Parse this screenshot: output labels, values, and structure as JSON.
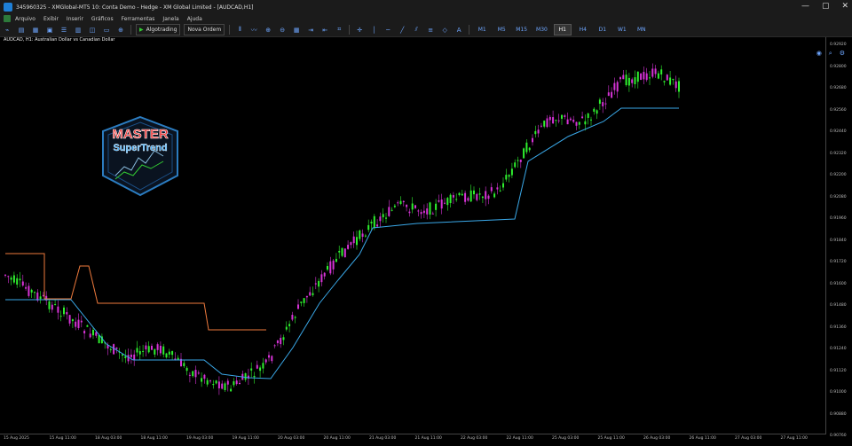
{
  "window": {
    "title": "345960325 - XMGlobal-MT5 10: Conta Demo - Hedge - XM Global Limited - [AUDCAD,H1]",
    "controls": [
      "—",
      "▢",
      "✕"
    ]
  },
  "menu": [
    "Arquivo",
    "Exibir",
    "Inserir",
    "Gráficos",
    "Ferramentas",
    "Janela",
    "Ajuda"
  ],
  "toolbar": {
    "algo_label": "Algotrading",
    "new_order_label": "Nova Ordem",
    "timeframes": [
      "M1",
      "M5",
      "M15",
      "M30",
      "H1",
      "H4",
      "D1",
      "W1",
      "MN"
    ],
    "active_timeframe": "H1"
  },
  "chart": {
    "header": "AUDCAD, H1:  Australian Dollar vs Canadian Dollar",
    "price_labels": [
      "0.92920",
      "0.92800",
      "0.92680",
      "0.92560",
      "0.92440",
      "0.92320",
      "0.92200",
      "0.92080",
      "0.91960",
      "0.91840",
      "0.91720",
      "0.91600",
      "0.91480",
      "0.91360",
      "0.91240",
      "0.91120",
      "0.91000",
      "0.90880",
      "0.90760"
    ],
    "time_labels": [
      "15 Aug 2025",
      "15 Aug 11:00",
      "18 Aug 03:00",
      "18 Aug 11:00",
      "19 Aug 03:00",
      "19 Aug 11:00",
      "20 Aug 03:00",
      "20 Aug 11:00",
      "21 Aug 03:00",
      "21 Aug 11:00",
      "22 Aug 03:00",
      "22 Aug 11:00",
      "25 Aug 03:00",
      "25 Aug 11:00",
      "26 Aug 03:00",
      "26 Aug 11:00",
      "27 Aug 03:00",
      "27 Aug 11:00"
    ],
    "badge_text_line1": "MASTER",
    "badge_text_line2": "SuperTrend",
    "colors": {
      "bull": "#2ef02e",
      "bear": "#d633d6",
      "trend_up": "#3aa8e8",
      "trend_down": "#ee7a3c"
    }
  }
}
